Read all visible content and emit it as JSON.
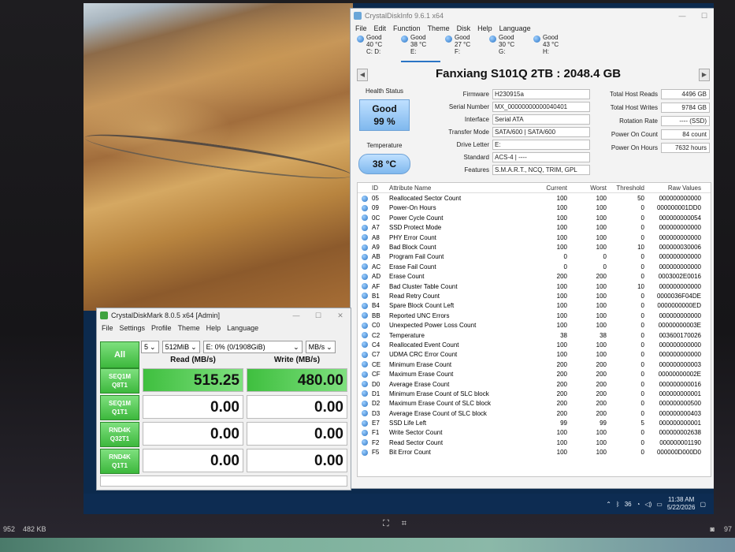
{
  "cdi": {
    "title": "CrystalDiskInfo 9.6.1 x64",
    "menu": [
      "File",
      "Edit",
      "Function",
      "Theme",
      "Disk",
      "Help",
      "Language"
    ],
    "drives": [
      {
        "status": "Good",
        "temp": "40 °C",
        "letter": "C: D:"
      },
      {
        "status": "Good",
        "temp": "38 °C",
        "letter": "E:"
      },
      {
        "status": "Good",
        "temp": "27 °C",
        "letter": "F:"
      },
      {
        "status": "Good",
        "temp": "30 °C",
        "letter": "G:"
      },
      {
        "status": "Good",
        "temp": "43 °C",
        "letter": "H:"
      }
    ],
    "disk_title": "Fanxiang S101Q 2TB : 2048.4 GB",
    "health_label": "Health Status",
    "health_status": "Good",
    "health_percent": "99 %",
    "temp_label": "Temperature",
    "temperature": "38 °C",
    "info": [
      {
        "k": "Firmware",
        "v": "H230915a"
      },
      {
        "k": "Serial Number",
        "v": "MX_00000000000040401"
      },
      {
        "k": "Interface",
        "v": "Serial ATA"
      },
      {
        "k": "Transfer Mode",
        "v": "SATA/600 | SATA/600"
      },
      {
        "k": "Drive Letter",
        "v": "E:"
      },
      {
        "k": "Standard",
        "v": "ACS-4 | ----"
      },
      {
        "k": "Features",
        "v": "S.M.A.R.T., NCQ, TRIM, GPL"
      }
    ],
    "stats": [
      {
        "k": "Total Host Reads",
        "v": "4496 GB"
      },
      {
        "k": "Total Host Writes",
        "v": "9784 GB"
      },
      {
        "k": "Rotation Rate",
        "v": "---- (SSD)"
      },
      {
        "k": "Power On Count",
        "v": "84 count"
      },
      {
        "k": "Power On Hours",
        "v": "7632 hours"
      }
    ],
    "smart_headers": [
      "ID",
      "Attribute Name",
      "Current",
      "Worst",
      "Threshold",
      "Raw Values"
    ],
    "smart_rows": [
      [
        "05",
        "Reallocated Sector Count",
        "100",
        "100",
        "50",
        "000000000000"
      ],
      [
        "09",
        "Power-On Hours",
        "100",
        "100",
        "0",
        "000000001DD0"
      ],
      [
        "0C",
        "Power Cycle Count",
        "100",
        "100",
        "0",
        "000000000054"
      ],
      [
        "A7",
        "SSD Protect Mode",
        "100",
        "100",
        "0",
        "000000000000"
      ],
      [
        "A8",
        "PHY Error Count",
        "100",
        "100",
        "0",
        "000000000000"
      ],
      [
        "A9",
        "Bad Block Count",
        "100",
        "100",
        "10",
        "000000030006"
      ],
      [
        "AB",
        "Program Fail Count",
        "0",
        "0",
        "0",
        "000000000000"
      ],
      [
        "AC",
        "Erase Fail Count",
        "0",
        "0",
        "0",
        "000000000000"
      ],
      [
        "AD",
        "Erase Count",
        "200",
        "200",
        "0",
        "0003002E0016"
      ],
      [
        "AF",
        "Bad Cluster Table Count",
        "100",
        "100",
        "10",
        "000000000000"
      ],
      [
        "B1",
        "Read Retry Count",
        "100",
        "100",
        "0",
        "0000036F04DE"
      ],
      [
        "B4",
        "Spare Block Count Left",
        "100",
        "100",
        "0",
        "0000000000ED"
      ],
      [
        "BB",
        "Reported UNC Errors",
        "100",
        "100",
        "0",
        "000000000000"
      ],
      [
        "C0",
        "Unexpected Power Loss Count",
        "100",
        "100",
        "0",
        "00000000003E"
      ],
      [
        "C2",
        "Temperature",
        "38",
        "38",
        "0",
        "003600170026"
      ],
      [
        "C4",
        "Reallocated Event Count",
        "100",
        "100",
        "0",
        "000000000000"
      ],
      [
        "C7",
        "UDMA CRC Error Count",
        "100",
        "100",
        "0",
        "000000000000"
      ],
      [
        "CE",
        "Minimum Erase Count",
        "200",
        "200",
        "0",
        "000000000003"
      ],
      [
        "CF",
        "Maximum Erase Count",
        "200",
        "200",
        "0",
        "00000000002E"
      ],
      [
        "D0",
        "Average Erase Count",
        "200",
        "200",
        "0",
        "000000000016"
      ],
      [
        "D1",
        "Minimum Erase Count of SLC block",
        "200",
        "200",
        "0",
        "000000000001"
      ],
      [
        "D2",
        "Maximum Erase Count of SLC block",
        "200",
        "200",
        "0",
        "000000000500"
      ],
      [
        "D3",
        "Average Erase Count of SLC block",
        "200",
        "200",
        "0",
        "000000000403"
      ],
      [
        "E7",
        "SSD Life Left",
        "99",
        "99",
        "5",
        "000000000001"
      ],
      [
        "F1",
        "Write Sector Count",
        "100",
        "100",
        "0",
        "000000002638"
      ],
      [
        "F2",
        "Read Sector Count",
        "100",
        "100",
        "0",
        "000000001190"
      ],
      [
        "F5",
        "Bit Error Count",
        "100",
        "100",
        "0",
        "000000D000D0"
      ]
    ]
  },
  "cdm": {
    "title": "CrystalDiskMark 8.0.5 x64 [Admin]",
    "menu": [
      "File",
      "Settings",
      "Profile",
      "Theme",
      "Help",
      "Language"
    ],
    "all_label": "All",
    "count": "5",
    "size": "512MiB",
    "drive": "E: 0% (0/1908GiB)",
    "unit": "MB/s",
    "read_header": "Read (MB/s)",
    "write_header": "Write (MB/s)",
    "rows": [
      {
        "test1": "SEQ1M",
        "test2": "Q8T1",
        "read": "515.25",
        "write": "480.00"
      },
      {
        "test1": "SEQ1M",
        "test2": "Q1T1",
        "read": "0.00",
        "write": "0.00"
      },
      {
        "test1": "RND4K",
        "test2": "Q32T1",
        "read": "0.00",
        "write": "0.00"
      },
      {
        "test1": "RND4K",
        "test2": "Q1T1",
        "read": "0.00",
        "write": "0.00"
      }
    ]
  },
  "taskbar": {
    "time": "11:38 AM",
    "date": "5/22/2026",
    "badge": "36"
  },
  "photo_overlay": {
    "left1": "952",
    "left2": "482 KB",
    "right": "97"
  }
}
